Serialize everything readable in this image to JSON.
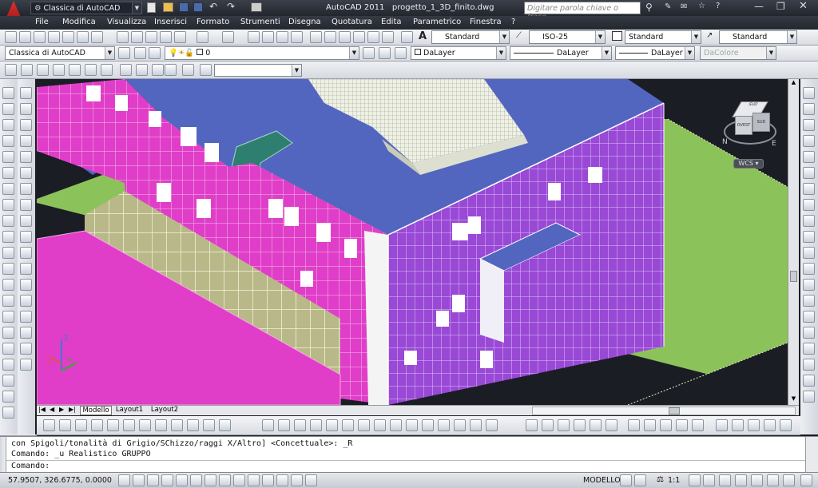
{
  "titlebar": {
    "workspace": "Classica di AutoCAD",
    "app": "AutoCAD 2011",
    "file": "progetto_1_3D_finito.dwg",
    "search_placeholder": "Digitare parola chiave o frase"
  },
  "menu": [
    "File",
    "Modifica",
    "Visualizza",
    "Inserisci",
    "Formato",
    "Strumenti",
    "Disegna",
    "Quotatura",
    "Edita",
    "Parametrico",
    "Finestra",
    "?"
  ],
  "styles": {
    "text_style": "Standard",
    "dim_style": "ISO-25",
    "table_style": "Standard",
    "multileader_style": "Standard"
  },
  "layers": {
    "workspace": "Classica di AutoCAD",
    "current_layer": "0",
    "color": "DaLayer",
    "linetype": "DaLayer",
    "lineweight": "DaLayer",
    "plotstyle": "DaColore"
  },
  "viewcube": {
    "face_top": "SUD",
    "face_front": "OVEST",
    "face_right": "SUD",
    "compass_left": "N",
    "compass_right": "E",
    "wcs": "WCS"
  },
  "tabs": [
    "Modello",
    "Layout1",
    "Layout2"
  ],
  "command": {
    "line1": "con Spigoli/tonalità di Grigio/SChizzo/raggi X/Altro] <Concettuale>: _R",
    "line2": "Comando: _u Realistico GRUPPO",
    "line3": "Comando:"
  },
  "status": {
    "coords": "57.9507, 326.6775, 0.0000",
    "model": "MODELLO",
    "scale": "1:1"
  },
  "colors": {
    "accent_magenta": "#e040c8",
    "facade_purple": "#9a4ad8",
    "roof_blue": "#5266c0",
    "ground_green": "#88c057",
    "teal": "#2f7f70"
  }
}
